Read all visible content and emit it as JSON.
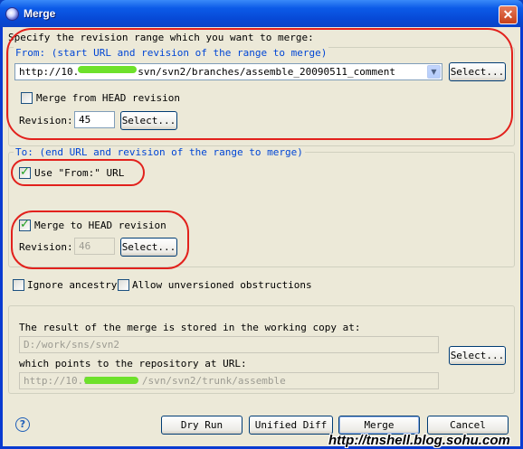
{
  "window": {
    "title": "Merge"
  },
  "intro": "Specify the revision range which you want to merge:",
  "from": {
    "legend": "From: (start URL and revision of the range to merge)",
    "url_pre": "http://10.",
    "url_post": "svn/svn2/branches/assemble_20090511_comment",
    "select_label": "Select...",
    "head_label": "Merge from HEAD revision",
    "head_checked": false,
    "revision_label": "Revision:",
    "revision_value": "45",
    "rev_select_label": "Select..."
  },
  "to": {
    "legend": "To: (end URL and revision of the range to merge)",
    "use_from_label": "Use \"From:\" URL",
    "use_from_checked": true,
    "head_label": "Merge to HEAD revision",
    "head_checked": true,
    "revision_label": "Revision:",
    "revision_value": "46",
    "rev_select_label": "Select..."
  },
  "options": {
    "ignore_ancestry": "Ignore ancestry",
    "allow_unversioned": "Allow unversioned obstructions"
  },
  "result": {
    "stored_text": "The result of the merge is stored in the working copy at:",
    "working_copy": "D:/work/sns/svn2",
    "points_text": "which points to the repository at URL:",
    "repo_url_pre": "http://10.1",
    "repo_url_post": "/svn/svn2/trunk/assemble",
    "select_label": "Select..."
  },
  "buttons": {
    "dry_run": "Dry Run",
    "unified_diff": "Unified Diff",
    "merge": "Merge",
    "cancel": "Cancel"
  },
  "help_icon": "help-icon",
  "watermark": "http://tnshell.blog.sohu.com",
  "colors": {
    "accent": "#0046d5",
    "annotation": "#e2211c",
    "redaction": "#6ee12b"
  }
}
